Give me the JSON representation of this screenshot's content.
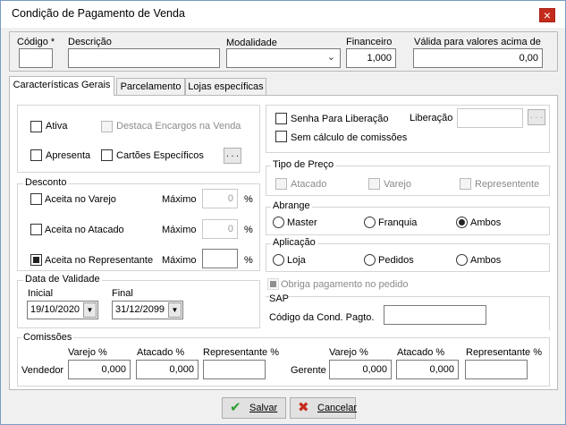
{
  "window": {
    "title": "Condição de Pagamento de Venda",
    "close_glyph": "×"
  },
  "header": {
    "codigo_label": "Código *",
    "codigo_value": "",
    "descricao_label": "Descrição",
    "descricao_value": "",
    "modalidade_label": "Modalidade",
    "modalidade_value": "",
    "financeiro_label": "Financeiro",
    "financeiro_value": "1,000",
    "valida_label": "Válida para valores acima de",
    "valida_value": "0,00"
  },
  "tabs": [
    {
      "label": "Características Gerais",
      "active": true
    },
    {
      "label": "Parcelamento",
      "active": false
    },
    {
      "label": "Lojas específicas",
      "active": false
    }
  ],
  "general": {
    "ativa_label": "Ativa",
    "ativa_checked": false,
    "destaca_label": "Destaca  Encargos na Venda",
    "apresenta_label": "Apresenta",
    "cartoes_label": "Cartões Específicos",
    "dots_label": ". . ."
  },
  "desconto": {
    "title": "Desconto",
    "maximo_label": "Máximo",
    "percent": "%",
    "rows": [
      {
        "label": "Aceita no Varejo",
        "checked": false,
        "value": "0"
      },
      {
        "label": "Aceita no Atacado",
        "checked": false,
        "value": "0"
      },
      {
        "label": "Aceita no Representante",
        "checked": true,
        "value": ""
      }
    ]
  },
  "validade": {
    "title": "Data de Validade",
    "inicial_label": "Inicial",
    "inicial_value": "19/10/2020",
    "final_label": "Final",
    "final_value": "31/12/2099",
    "dropdown_glyph": "▼"
  },
  "liberacao": {
    "senha_label": "Senha Para Liberação",
    "sem_calculo_label": "Sem cálculo de comissões",
    "liberacao_label": "Liberação",
    "liberacao_value": "",
    "dots_label": ". . ."
  },
  "tipo_preco": {
    "title": "Tipo de Preço",
    "options": [
      "Atacado",
      "Varejo",
      "Representente"
    ]
  },
  "abrange": {
    "title": "Abrange",
    "options": [
      "Master",
      "Franquia",
      "Ambos"
    ],
    "selected": "Ambos"
  },
  "aplicacao": {
    "title": "Aplicação",
    "options": [
      "Loja",
      "Pedidos",
      "Ambos"
    ],
    "selected": ""
  },
  "obriga": {
    "label": "Obriga pagamento no pedido"
  },
  "sap": {
    "title": "SAP",
    "codigo_label": "Código da Cond. Pagto.",
    "codigo_value": ""
  },
  "comissoes": {
    "title": "Comissões",
    "vendedor_label": "Vendedor",
    "gerente_label": "Gerente",
    "varejo_label": "Varejo %",
    "atacado_label": "Atacado %",
    "representante_label": "Representante %",
    "vendedor": {
      "varejo": "0,000",
      "atacado": "0,000",
      "representante": ""
    },
    "gerente": {
      "varejo": "0,000",
      "atacado": "0,000",
      "representante": ""
    }
  },
  "buttons": {
    "salvar": "Salvar",
    "cancelar": "Cancelar",
    "salvar_icon": "check-icon",
    "cancelar_icon": "x-icon"
  },
  "colors": {
    "check_green": "#2e9e2e",
    "cancel_red": "#c42b1c",
    "close_red": "#c42b1c"
  }
}
